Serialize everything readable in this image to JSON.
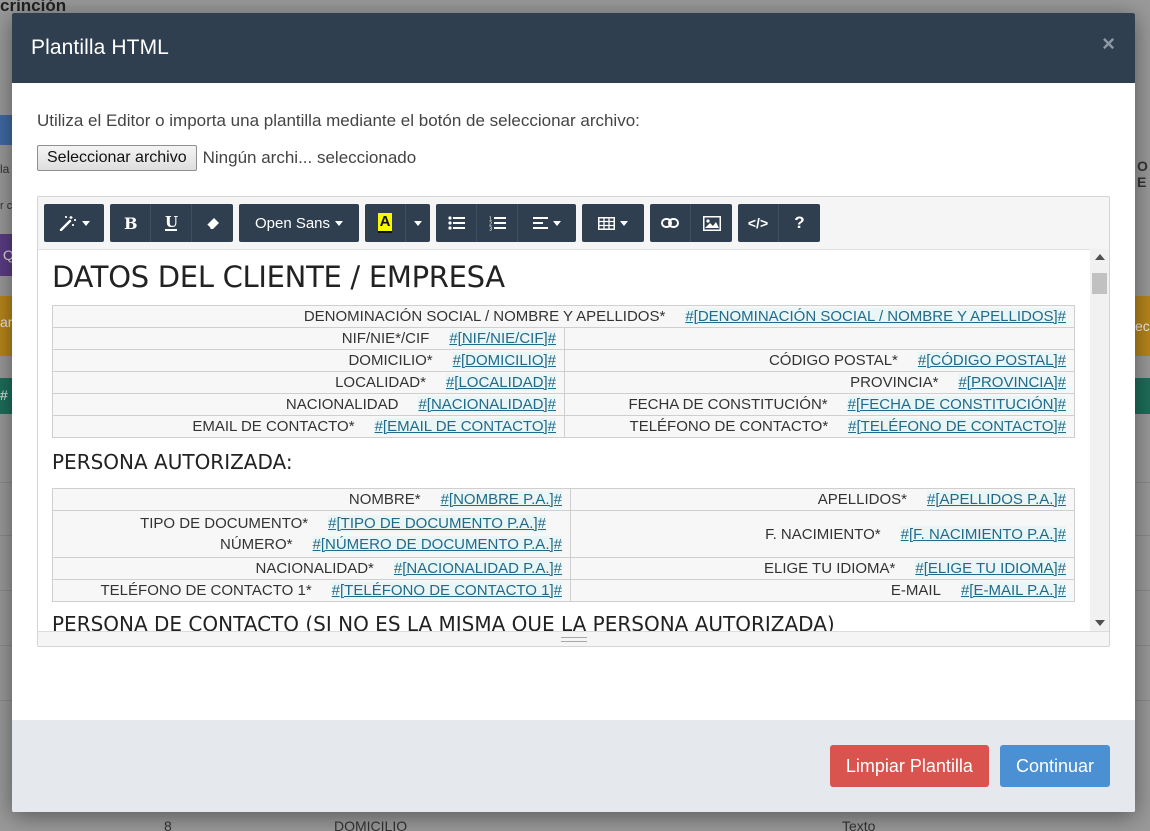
{
  "background": {
    "title_fragment": "crinción",
    "bottom_cells": [
      "8",
      "DOMICILIO",
      "Texto"
    ],
    "side_fragments": [
      "la",
      "O E",
      "r c",
      "Q",
      "ar",
      "ecc",
      "#"
    ]
  },
  "modal": {
    "title": "Plantilla HTML",
    "close_symbol": "×",
    "intro": "Utiliza el Editor o importa una plantilla mediante el botón de seleccionar archivo:",
    "file_button": "Seleccionar archivo",
    "file_status": "Ningún archi... seleccionado",
    "toolbar": {
      "font_name": "Open Sans",
      "highlight_letter": "A",
      "help": "?",
      "code": "</>"
    },
    "document": {
      "section1_title": "DATOS DEL CLIENTE / EMPRESA",
      "section1_rows": [
        {
          "label": "DENOMINACIÓN SOCIAL / NOMBRE Y APELLIDOS*",
          "tag": "#[DENOMINACIÓN SOCIAL / NOMBRE Y APELLIDOS]#"
        },
        {
          "left_label": "NIF/NIE*/CIF",
          "left_tag": "#[NIF/NIE/CIF]#",
          "right_label": "",
          "right_tag": ""
        },
        {
          "left_label": "DOMICILIO*",
          "left_tag": "#[DOMICILIO]#",
          "right_label": "CÓDIGO POSTAL*",
          "right_tag": "#[CÓDIGO POSTAL]#"
        },
        {
          "left_label": "LOCALIDAD*",
          "left_tag": "#[LOCALIDAD]#",
          "right_label": "PROVINCIA*",
          "right_tag": "#[PROVINCIA]#"
        },
        {
          "left_label": "NACIONALIDAD",
          "left_tag": "#[NACIONALIDAD]#",
          "right_label": "FECHA DE CONSTITUCIÓN*",
          "right_tag": "#[FECHA DE CONSTITUCIÓN]#"
        },
        {
          "left_label": "EMAIL DE CONTACTO*",
          "left_tag": "#[EMAIL DE CONTACTO]#",
          "right_label": "TELÉFONO DE CONTACTO*",
          "right_tag": "#[TELÉFONO DE CONTACTO]#"
        }
      ],
      "section2_title": "PERSONA AUTORIZADA:",
      "section2_rows": [
        {
          "left_label": "NOMBRE*",
          "left_tag": "#[NOMBRE P.A.]#",
          "right_label": "APELLIDOS*",
          "right_tag": "#[APELLIDOS P.A.]#"
        },
        {
          "left_label": "TIPO DE DOCUMENTO*",
          "left_tag": "#[TIPO DE DOCUMENTO P.A.]#",
          "left_label2": "NÚMERO*",
          "left_tag2": "#[NÚMERO DE DOCUMENTO P.A.]#",
          "right_label": "F. NACIMIENTO*",
          "right_tag": "#[F. NACIMIENTO P.A.]#"
        },
        {
          "left_label": "NACIONALIDAD*",
          "left_tag": "#[NACIONALIDAD P.A.]#",
          "right_label": "ELIGE TU IDIOMA*",
          "right_tag": "#[ELIGE TU IDIOMA]#"
        },
        {
          "left_label": "TELÉFONO DE CONTACTO 1*",
          "left_tag": "#[TELÉFONO DE CONTACTO 1]#",
          "right_label": "E-MAIL",
          "right_tag": "#[E-MAIL P.A.]#"
        }
      ],
      "section3_title_partial": "PERSONA DE CONTACTO (SI NO ES LA MISMA QUE LA PERSONA AUTORIZADA)"
    },
    "footer": {
      "clear_button": "Limpiar Plantilla",
      "continue_button": "Continuar"
    },
    "colors": {
      "header": "#2f3f50",
      "danger": "#d9534f",
      "primary": "#4a90d2",
      "footer": "#e5e9ed",
      "tag": "#226a8a"
    }
  }
}
